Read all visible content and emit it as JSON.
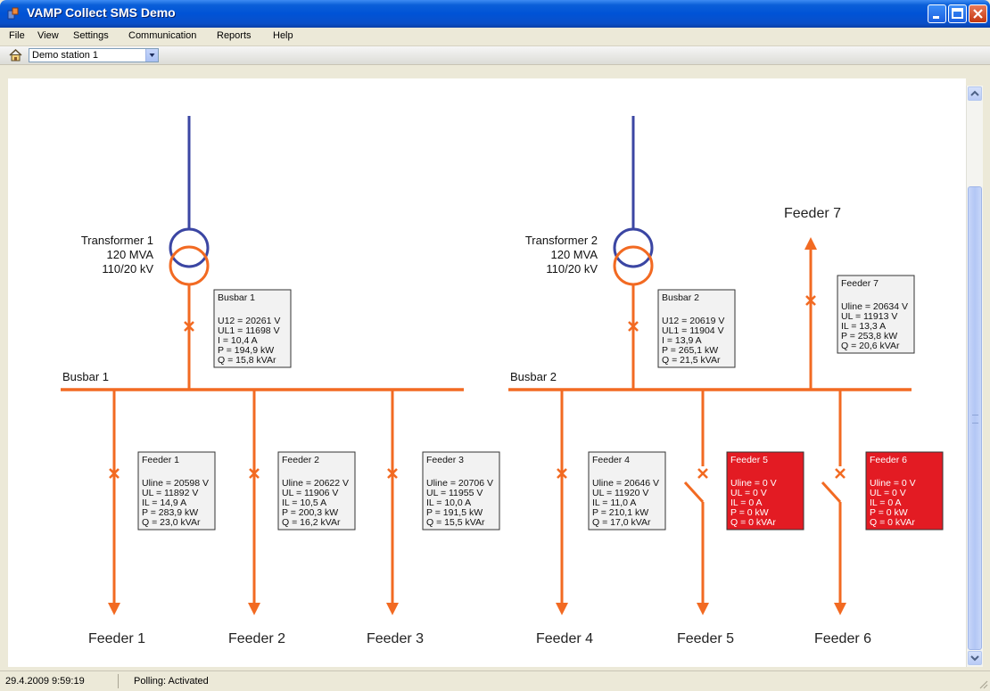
{
  "window": {
    "title": "VAMP Collect SMS Demo"
  },
  "menu": [
    "File",
    "View",
    "Settings",
    "Communication",
    "Reports",
    "Help"
  ],
  "toolbar": {
    "station": "Demo station 1"
  },
  "status": {
    "datetime": "29.4.2009 9:59:19",
    "polling": "Polling:  Activated"
  },
  "colors": {
    "line": "#f26a22",
    "transformer": "#3b46a3",
    "alarm": "#e31b23",
    "panel": "#f2f2f2"
  },
  "transformers": [
    {
      "name": "Transformer 1",
      "rating": "120 MVA",
      "ratio": "110/20 kV"
    },
    {
      "name": "Transformer 2",
      "rating": "120 MVA",
      "ratio": "110/20 kV"
    }
  ],
  "busbars": [
    {
      "label": "Busbar 1",
      "title": "Busbar 1",
      "lines": [
        "U12 = 20261 V",
        "UL1 = 11698 V",
        "I = 10,4 A",
        "P = 194,9 kW",
        "Q = 15,8 kVAr"
      ]
    },
    {
      "label": "Busbar 2",
      "title": "Busbar 2",
      "lines": [
        "U12 = 20619 V",
        "UL1 = 11904 V",
        "I = 13,9 A",
        "P = 265,1 kW",
        "Q = 21,5 kVAr"
      ]
    }
  ],
  "feeders": [
    {
      "label": "Feeder 1",
      "title": "Feeder 1",
      "alarm": false,
      "lines": [
        "Uline = 20598 V",
        "UL = 11892 V",
        "IL = 14,9 A",
        "P = 283,9 kW",
        "Q = 23,0 kVAr"
      ]
    },
    {
      "label": "Feeder 2",
      "title": "Feeder 2",
      "alarm": false,
      "lines": [
        "Uline = 20622 V",
        "UL = 11906 V",
        "IL = 10,5 A",
        "P = 200,3 kW",
        "Q = 16,2 kVAr"
      ]
    },
    {
      "label": "Feeder 3",
      "title": "Feeder 3",
      "alarm": false,
      "lines": [
        "Uline = 20706 V",
        "UL = 11955 V",
        "IL = 10,0 A",
        "P = 191,5 kW",
        "Q = 15,5 kVAr"
      ]
    },
    {
      "label": "Feeder 4",
      "title": "Feeder 4",
      "alarm": false,
      "lines": [
        "Uline = 20646 V",
        "UL = 11920 V",
        "IL = 11,0 A",
        "P = 210,1 kW",
        "Q = 17,0 kVAr"
      ]
    },
    {
      "label": "Feeder 5",
      "title": "Feeder 5",
      "alarm": true,
      "lines": [
        "Uline = 0 V",
        "UL = 0 V",
        "IL = 0 A",
        "P = 0 kW",
        "Q = 0 kVAr"
      ]
    },
    {
      "label": "Feeder 6",
      "title": "Feeder 6",
      "alarm": true,
      "lines": [
        "Uline = 0 V",
        "UL = 0 V",
        "IL = 0 A",
        "P = 0 kW",
        "Q = 0 kVAr"
      ]
    },
    {
      "label": "Feeder 7",
      "title": "Feeder 7",
      "alarm": false,
      "lines": [
        "Uline = 20634 V",
        "UL = 11913 V",
        "IL = 13,3 A",
        "P = 253,8 kW",
        "Q = 20,6 kVAr"
      ]
    }
  ]
}
